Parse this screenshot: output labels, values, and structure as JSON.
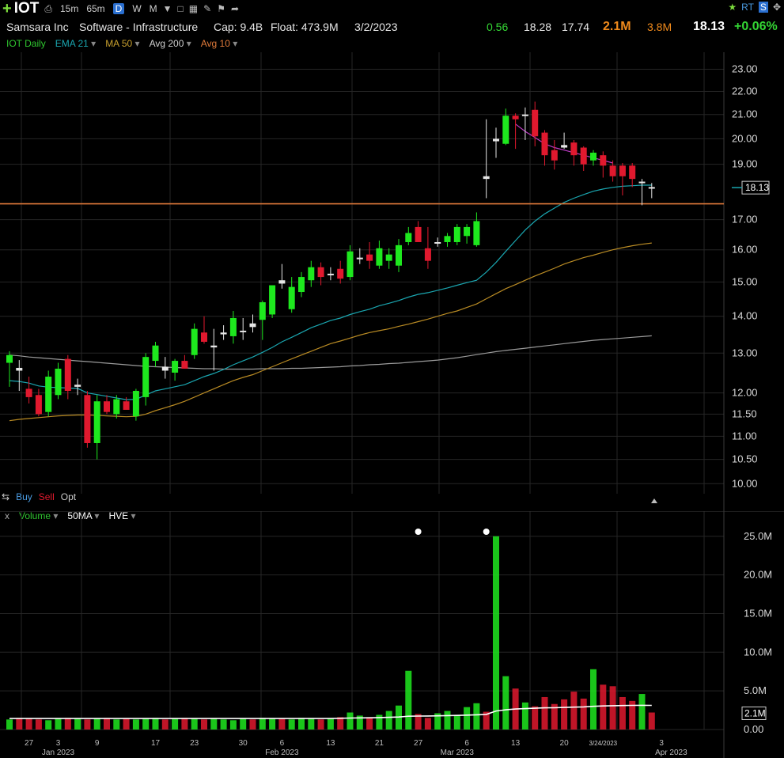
{
  "toolbar": {
    "ticker": "IOT",
    "timeframes": [
      "15m",
      "65m",
      "D",
      "W",
      "M"
    ],
    "active_timeframe": "D"
  },
  "info": {
    "company": "Samsara Inc",
    "sector": "Software - Infrastructure",
    "cap": "Cap: 9.4B",
    "float": "Float: 473.9M",
    "date": "3/2/2023",
    "change": "0.56",
    "high": "18.28",
    "low": "17.74",
    "volume": "2.1M",
    "avg_volume": "3.8M",
    "last": "18.13",
    "pct_change": "+0.06%"
  },
  "indicators": {
    "chart_name": "IOT Daily",
    "ema": "EMA 21",
    "ma50": "MA 50",
    "avg200": "Avg 200",
    "avg10": "Avg 10"
  },
  "trade": {
    "buy": "Buy",
    "sell": "Sell",
    "opt": "Opt"
  },
  "volume_panel": {
    "close": "x",
    "volume": "Volume",
    "ma": "50MA",
    "hve": "HVE"
  },
  "colors": {
    "up": "#1ee81e",
    "down": "#e0192e",
    "doji": "#e6e6e6",
    "ema21": "#1aa6b0",
    "ma50": "#b98b24",
    "ma200": "#9a9a9a",
    "avg10": "#c03cc8",
    "hline": "#e07a3a",
    "vol_ma": "#ffffff"
  },
  "chart_data": [
    {
      "type": "candlestick",
      "ylim": [
        9.8,
        23.5
      ],
      "log_scale": true,
      "grid": true,
      "price_ticks": [
        10.0,
        10.5,
        11.0,
        11.5,
        12.0,
        13.0,
        14.0,
        15.0,
        16.0,
        17.0,
        19.0,
        20.0,
        21.0,
        22.0,
        23.0
      ],
      "x_labels": [
        {
          "i": 2,
          "label": "27"
        },
        {
          "i": 5,
          "label": "Jan 2023"
        },
        {
          "i": 5,
          "label": "3"
        },
        {
          "i": 9,
          "label": "9"
        },
        {
          "i": 15,
          "label": "17"
        },
        {
          "i": 19,
          "label": "23"
        },
        {
          "i": 24,
          "label": "30"
        },
        {
          "i": 28,
          "label": "Feb 2023"
        },
        {
          "i": 28,
          "label": "6"
        },
        {
          "i": 33,
          "label": "13"
        },
        {
          "i": 38,
          "label": "21"
        },
        {
          "i": 42,
          "label": "27"
        },
        {
          "i": 46,
          "label": "Mar 2023"
        },
        {
          "i": 47,
          "label": "6"
        },
        {
          "i": 52,
          "label": "13"
        },
        {
          "i": 57,
          "label": "20"
        },
        {
          "i": 61,
          "label": "3/24/2023"
        },
        {
          "i": 67,
          "label": "3"
        },
        {
          "i": 68,
          "label": "Apr 2023"
        }
      ],
      "candles": [
        {
          "o": 12.75,
          "h": 13.05,
          "l": 12.15,
          "c": 12.95
        },
        {
          "o": 12.62,
          "h": 12.82,
          "l": 12.05,
          "c": 12.55
        },
        {
          "o": 12.1,
          "h": 12.4,
          "l": 11.75,
          "c": 11.9
        },
        {
          "o": 11.95,
          "h": 12.1,
          "l": 11.45,
          "c": 11.5
        },
        {
          "o": 11.55,
          "h": 12.55,
          "l": 11.45,
          "c": 12.4
        },
        {
          "o": 11.95,
          "h": 12.75,
          "l": 11.85,
          "c": 12.6
        },
        {
          "o": 12.85,
          "h": 12.95,
          "l": 11.85,
          "c": 12.05
        },
        {
          "o": 12.15,
          "h": 12.35,
          "l": 11.95,
          "c": 12.2
        },
        {
          "o": 11.95,
          "h": 12.05,
          "l": 10.75,
          "c": 10.85
        },
        {
          "o": 10.85,
          "h": 11.95,
          "l": 10.5,
          "c": 11.8
        },
        {
          "o": 11.8,
          "h": 11.95,
          "l": 11.5,
          "c": 11.55
        },
        {
          "o": 11.5,
          "h": 11.95,
          "l": 11.4,
          "c": 11.85
        },
        {
          "o": 11.8,
          "h": 11.9,
          "l": 11.65,
          "c": 11.6
        },
        {
          "o": 11.45,
          "h": 12.1,
          "l": 11.35,
          "c": 12.05
        },
        {
          "o": 11.9,
          "h": 13.0,
          "l": 11.7,
          "c": 12.9
        },
        {
          "o": 12.8,
          "h": 13.3,
          "l": 12.65,
          "c": 13.2
        },
        {
          "o": 12.65,
          "h": 12.9,
          "l": 12.35,
          "c": 12.55
        },
        {
          "o": 12.5,
          "h": 12.85,
          "l": 12.3,
          "c": 12.8
        },
        {
          "o": 12.8,
          "h": 12.95,
          "l": 12.6,
          "c": 12.6
        },
        {
          "o": 12.95,
          "h": 13.8,
          "l": 12.85,
          "c": 13.65
        },
        {
          "o": 13.55,
          "h": 14.0,
          "l": 13.25,
          "c": 13.3
        },
        {
          "o": 13.15,
          "h": 13.65,
          "l": 12.55,
          "c": 13.2
        },
        {
          "o": 13.5,
          "h": 13.75,
          "l": 13.35,
          "c": 13.55
        },
        {
          "o": 13.45,
          "h": 14.15,
          "l": 13.25,
          "c": 13.95
        },
        {
          "o": 13.6,
          "h": 13.95,
          "l": 13.35,
          "c": 13.6
        },
        {
          "o": 13.8,
          "h": 14.05,
          "l": 13.55,
          "c": 13.7
        },
        {
          "o": 13.9,
          "h": 14.45,
          "l": 13.35,
          "c": 14.4
        },
        {
          "o": 14.05,
          "h": 14.8,
          "l": 13.95,
          "c": 14.9
        },
        {
          "o": 15.05,
          "h": 15.55,
          "l": 14.8,
          "c": 14.95
        },
        {
          "o": 14.2,
          "h": 15.15,
          "l": 14.1,
          "c": 14.85
        },
        {
          "o": 14.7,
          "h": 15.3,
          "l": 14.55,
          "c": 15.15
        },
        {
          "o": 15.05,
          "h": 15.65,
          "l": 14.85,
          "c": 15.45
        },
        {
          "o": 15.45,
          "h": 15.6,
          "l": 14.9,
          "c": 15.15
        },
        {
          "o": 15.25,
          "h": 15.45,
          "l": 15.05,
          "c": 15.25
        },
        {
          "o": 15.4,
          "h": 15.65,
          "l": 14.95,
          "c": 15.1
        },
        {
          "o": 15.15,
          "h": 16.15,
          "l": 15.05,
          "c": 15.95
        },
        {
          "o": 15.75,
          "h": 16.05,
          "l": 15.55,
          "c": 15.75
        },
        {
          "o": 15.85,
          "h": 16.25,
          "l": 15.4,
          "c": 15.65
        },
        {
          "o": 15.5,
          "h": 16.3,
          "l": 15.4,
          "c": 16.05
        },
        {
          "o": 15.65,
          "h": 16.05,
          "l": 15.4,
          "c": 15.85
        },
        {
          "o": 15.5,
          "h": 16.35,
          "l": 15.3,
          "c": 16.15
        },
        {
          "o": 16.25,
          "h": 16.75,
          "l": 16.15,
          "c": 16.55
        },
        {
          "o": 16.75,
          "h": 16.95,
          "l": 16.4,
          "c": 16.25
        },
        {
          "o": 16.05,
          "h": 16.75,
          "l": 15.4,
          "c": 15.65
        },
        {
          "o": 16.2,
          "h": 16.4,
          "l": 16.1,
          "c": 16.25
        },
        {
          "o": 16.25,
          "h": 16.55,
          "l": 16.1,
          "c": 16.45
        },
        {
          "o": 16.25,
          "h": 16.85,
          "l": 16.15,
          "c": 16.75
        },
        {
          "o": 16.45,
          "h": 16.85,
          "l": 16.2,
          "c": 16.75
        },
        {
          "o": 16.15,
          "h": 17.25,
          "l": 16.1,
          "c": 16.95
        },
        {
          "o": 18.55,
          "h": 20.8,
          "l": 17.75,
          "c": 18.45
        },
        {
          "o": 19.9,
          "h": 20.45,
          "l": 19.25,
          "c": 20.0
        },
        {
          "o": 19.8,
          "h": 21.25,
          "l": 19.75,
          "c": 20.95
        },
        {
          "o": 20.95,
          "h": 21.05,
          "l": 19.6,
          "c": 20.8
        },
        {
          "o": 20.95,
          "h": 21.3,
          "l": 19.95,
          "c": 21.0
        },
        {
          "o": 21.2,
          "h": 21.55,
          "l": 19.7,
          "c": 20.1
        },
        {
          "o": 20.25,
          "h": 20.35,
          "l": 18.95,
          "c": 19.35
        },
        {
          "o": 19.55,
          "h": 19.95,
          "l": 18.8,
          "c": 19.15
        },
        {
          "o": 19.75,
          "h": 20.25,
          "l": 19.6,
          "c": 19.65
        },
        {
          "o": 19.85,
          "h": 19.95,
          "l": 18.95,
          "c": 19.35
        },
        {
          "o": 19.65,
          "h": 19.7,
          "l": 18.75,
          "c": 19.0
        },
        {
          "o": 19.15,
          "h": 19.55,
          "l": 18.95,
          "c": 19.45
        },
        {
          "o": 19.35,
          "h": 19.5,
          "l": 18.5,
          "c": 18.95
        },
        {
          "o": 18.95,
          "h": 19.15,
          "l": 18.35,
          "c": 18.55
        },
        {
          "o": 18.95,
          "h": 19.05,
          "l": 17.85,
          "c": 18.55
        },
        {
          "o": 18.95,
          "h": 19.05,
          "l": 18.15,
          "c": 18.45
        },
        {
          "o": 18.35,
          "h": 18.45,
          "l": 17.5,
          "c": 18.35
        },
        {
          "o": 18.15,
          "h": 18.3,
          "l": 17.75,
          "c": 18.13
        }
      ],
      "ema21": [
        12.3,
        12.28,
        12.24,
        12.17,
        12.14,
        12.13,
        12.12,
        12.11,
        12.0,
        11.96,
        11.92,
        11.88,
        11.84,
        11.85,
        11.95,
        12.05,
        12.1,
        12.15,
        12.2,
        12.3,
        12.4,
        12.48,
        12.58,
        12.7,
        12.8,
        12.9,
        13.02,
        13.15,
        13.3,
        13.42,
        13.55,
        13.68,
        13.78,
        13.88,
        13.95,
        14.05,
        14.13,
        14.2,
        14.3,
        14.37,
        14.45,
        14.55,
        14.63,
        14.68,
        14.75,
        14.82,
        14.9,
        14.98,
        15.05,
        15.3,
        15.6,
        15.95,
        16.3,
        16.65,
        16.95,
        17.2,
        17.4,
        17.6,
        17.75,
        17.88,
        18.0,
        18.08,
        18.14,
        18.18,
        18.2,
        18.22,
        18.22
      ],
      "ma50": [
        11.35,
        11.38,
        11.4,
        11.42,
        11.44,
        11.46,
        11.47,
        11.48,
        11.48,
        11.47,
        11.46,
        11.45,
        11.44,
        11.45,
        11.5,
        11.58,
        11.65,
        11.72,
        11.8,
        11.9,
        12.0,
        12.1,
        12.2,
        12.3,
        12.38,
        12.45,
        12.55,
        12.65,
        12.75,
        12.85,
        12.95,
        13.05,
        13.15,
        13.25,
        13.32,
        13.4,
        13.48,
        13.55,
        13.6,
        13.65,
        13.72,
        13.78,
        13.85,
        13.92,
        14.0,
        14.08,
        14.15,
        14.25,
        14.35,
        14.5,
        14.65,
        14.8,
        14.92,
        15.05,
        15.18,
        15.3,
        15.42,
        15.55,
        15.65,
        15.75,
        15.83,
        15.92,
        16.0,
        16.07,
        16.13,
        16.18,
        16.22
      ],
      "ma200": [
        12.95,
        12.93,
        12.9,
        12.88,
        12.86,
        12.84,
        12.82,
        12.8,
        12.78,
        12.76,
        12.74,
        12.72,
        12.7,
        12.68,
        12.66,
        12.65,
        12.64,
        12.63,
        12.62,
        12.61,
        12.6,
        12.6,
        12.59,
        12.59,
        12.59,
        12.59,
        12.6,
        12.6,
        12.6,
        12.61,
        12.61,
        12.62,
        12.63,
        12.64,
        12.65,
        12.67,
        12.68,
        12.7,
        12.71,
        12.73,
        12.74,
        12.76,
        12.78,
        12.8,
        12.82,
        12.85,
        12.88,
        12.92,
        12.96,
        13.0,
        13.04,
        13.07,
        13.1,
        13.13,
        13.16,
        13.19,
        13.22,
        13.25,
        13.28,
        13.31,
        13.34,
        13.36,
        13.38,
        13.4,
        13.42,
        13.44,
        13.46
      ],
      "avg10": [
        null,
        null,
        null,
        null,
        null,
        null,
        null,
        null,
        null,
        null,
        null,
        null,
        null,
        null,
        null,
        null,
        null,
        null,
        null,
        null,
        null,
        null,
        null,
        null,
        null,
        null,
        null,
        null,
        null,
        null,
        null,
        null,
        null,
        null,
        null,
        null,
        null,
        null,
        null,
        null,
        null,
        null,
        null,
        null,
        null,
        null,
        null,
        null,
        null,
        null,
        null,
        null,
        20.6,
        20.3,
        20.05,
        19.8,
        19.65,
        19.55,
        19.45,
        19.35,
        19.25,
        19.15,
        19.05
      ],
      "hline": 17.55
    },
    {
      "type": "bar",
      "title": "Volume",
      "ylim": [
        0,
        26
      ],
      "ticks": [
        "0.00",
        "5.0M",
        "10.0M",
        "15.0M",
        "20.0M",
        "25.0M"
      ],
      "tick_values": [
        0,
        5,
        10,
        15,
        20,
        25
      ],
      "current_label": "2.1M",
      "values": [
        1.3,
        1.5,
        1.4,
        1.3,
        1.2,
        1.4,
        1.5,
        1.4,
        1.3,
        1.4,
        1.5,
        1.3,
        1.4,
        1.3,
        1.4,
        1.5,
        1.3,
        1.4,
        1.5,
        1.4,
        1.3,
        1.4,
        1.3,
        1.2,
        1.4,
        1.3,
        1.5,
        1.4,
        1.4,
        1.3,
        1.5,
        1.4,
        1.3,
        1.4,
        1.6,
        2.2,
        1.8,
        1.6,
        1.9,
        2.4,
        3.1,
        7.6,
        2.0,
        1.5,
        2.1,
        2.4,
        1.9,
        2.9,
        3.4,
        2.3,
        25.0,
        6.9,
        5.3,
        3.5,
        3.0,
        4.2,
        3.3,
        3.9,
        4.9,
        4.0,
        7.8,
        5.8,
        5.6,
        4.2,
        3.7,
        4.6,
        2.2
      ],
      "ma": [
        1.42,
        1.42,
        1.42,
        1.42,
        1.42,
        1.42,
        1.42,
        1.42,
        1.42,
        1.42,
        1.42,
        1.42,
        1.42,
        1.42,
        1.42,
        1.42,
        1.42,
        1.42,
        1.42,
        1.42,
        1.42,
        1.42,
        1.42,
        1.42,
        1.42,
        1.42,
        1.42,
        1.42,
        1.42,
        1.42,
        1.42,
        1.42,
        1.42,
        1.42,
        1.45,
        1.48,
        1.5,
        1.52,
        1.55,
        1.58,
        1.62,
        1.72,
        1.74,
        1.75,
        1.77,
        1.8,
        1.82,
        1.86,
        1.9,
        1.95,
        2.4,
        2.55,
        2.65,
        2.7,
        2.75,
        2.8,
        2.82,
        2.86,
        2.9,
        2.93,
        3.0,
        3.05,
        3.08,
        3.1,
        3.12,
        3.13,
        3.12
      ],
      "hve_markers": [
        42,
        49
      ]
    }
  ]
}
